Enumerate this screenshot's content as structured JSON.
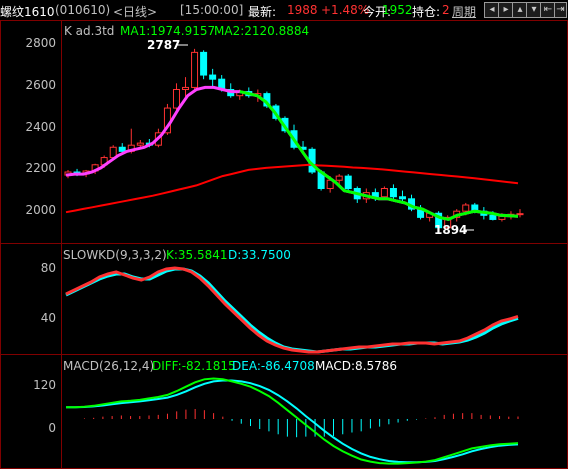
{
  "header": {
    "symbol": "螺纹1610",
    "code": "(010610)",
    "period": "<日线>",
    "time": "[15:00:00]",
    "last_label": "最新:",
    "last": "1988",
    "change": "+1.48%",
    "open_interest_label": "今开:",
    "open_interest": "1952",
    "position_label": "持仓:",
    "position": "2",
    "cycle_btn": "周期",
    "nav_icons": [
      "prev-icon",
      "next-icon",
      "zoom-in-icon",
      "zoom-out-icon",
      "first-icon",
      "last-icon"
    ]
  },
  "main_panel": {
    "title": "K  ad.3td",
    "ma1_label": "MA1:1974.9157",
    "ma2_label": "MA2:2120.8884",
    "high_marker": "2787",
    "low_marker": "1894",
    "y_ticks": [
      "2800",
      "2600",
      "2400",
      "2200",
      "2000"
    ]
  },
  "kd_panel": {
    "title": "SLOWKD(9,3,3,2)",
    "k_label": "K:35.5841",
    "d_label": "D:33.7500",
    "y_ticks": [
      "80",
      "40"
    ]
  },
  "macd_panel": {
    "title": "MACD(26,12,4)",
    "diff_label": "DIFF:-82.1815",
    "dea_label": "DEA:-86.4708",
    "macd_label": "MACD:8.5786",
    "y_ticks": [
      "120",
      "0"
    ]
  },
  "colors": {
    "up": "#ff3232",
    "down": "#00ffff",
    "ma1": "#ff40ff",
    "ma2": "#00ff00",
    "ma_long": "#ff0000",
    "grid": "#800000",
    "axis_text": "#c0c0c0",
    "title_text": "#c0c0c0",
    "green_label": "#00ff00",
    "cyan_label": "#00ffff",
    "white_label": "#ffffff"
  },
  "chart_data": [
    {
      "type": "candlestick",
      "title": "K ad.3td",
      "ylim": [
        1870,
        2830
      ],
      "series": [
        {
          "name": "MA1",
          "values": [
            2175,
            2180,
            2180,
            2190,
            2210,
            2240,
            2270,
            2290,
            2300,
            2310,
            2330,
            2370,
            2430,
            2500,
            2560,
            2590,
            2600,
            2600,
            2590,
            2580,
            2580,
            2570,
            2560,
            2530,
            2480,
            2420,
            2360,
            2300,
            2240,
            2200,
            2170,
            2140,
            2100,
            2090,
            2080,
            2070,
            2060,
            2060,
            2050,
            2040,
            2020,
            2010,
            1990,
            1970,
            1960,
            1980,
            1990,
            2000,
            1995,
            1990,
            1980,
            1978,
            1975
          ]
        },
        {
          "name": "MA2",
          "values": [
            1995,
            2003,
            2011,
            2019,
            2027,
            2035,
            2043,
            2051,
            2059,
            2067,
            2075,
            2085,
            2095,
            2105,
            2115,
            2125,
            2140,
            2155,
            2170,
            2180,
            2190,
            2200,
            2205,
            2210,
            2213,
            2216,
            2219,
            2222,
            2225,
            2222,
            2220,
            2218,
            2215,
            2212,
            2210,
            2207,
            2204,
            2200,
            2196,
            2192,
            2188,
            2184,
            2180,
            2176,
            2172,
            2168,
            2164,
            2160,
            2155,
            2150,
            2145,
            2140,
            2135
          ]
        }
      ],
      "candles": [
        {
          "o": 2175,
          "h": 2200,
          "l": 2160,
          "c": 2190
        },
        {
          "o": 2190,
          "h": 2205,
          "l": 2170,
          "c": 2180
        },
        {
          "o": 2180,
          "h": 2200,
          "l": 2165,
          "c": 2195
        },
        {
          "o": 2195,
          "h": 2230,
          "l": 2180,
          "c": 2225
        },
        {
          "o": 2225,
          "h": 2270,
          "l": 2210,
          "c": 2260
        },
        {
          "o": 2260,
          "h": 2320,
          "l": 2250,
          "c": 2310
        },
        {
          "o": 2310,
          "h": 2330,
          "l": 2280,
          "c": 2290
        },
        {
          "o": 2290,
          "h": 2400,
          "l": 2280,
          "c": 2320
        },
        {
          "o": 2320,
          "h": 2345,
          "l": 2300,
          "c": 2330
        },
        {
          "o": 2330,
          "h": 2350,
          "l": 2310,
          "c": 2320
        },
        {
          "o": 2320,
          "h": 2400,
          "l": 2310,
          "c": 2380
        },
        {
          "o": 2380,
          "h": 2520,
          "l": 2370,
          "c": 2500
        },
        {
          "o": 2500,
          "h": 2620,
          "l": 2490,
          "c": 2590
        },
        {
          "o": 2590,
          "h": 2650,
          "l": 2550,
          "c": 2600
        },
        {
          "o": 2600,
          "h": 2787,
          "l": 2580,
          "c": 2770
        },
        {
          "o": 2770,
          "h": 2780,
          "l": 2640,
          "c": 2660
        },
        {
          "o": 2660,
          "h": 2690,
          "l": 2600,
          "c": 2640
        },
        {
          "o": 2640,
          "h": 2660,
          "l": 2580,
          "c": 2590
        },
        {
          "o": 2590,
          "h": 2620,
          "l": 2550,
          "c": 2560
        },
        {
          "o": 2560,
          "h": 2590,
          "l": 2540,
          "c": 2580
        },
        {
          "o": 2580,
          "h": 2600,
          "l": 2550,
          "c": 2560
        },
        {
          "o": 2560,
          "h": 2590,
          "l": 2530,
          "c": 2570
        },
        {
          "o": 2570,
          "h": 2580,
          "l": 2500,
          "c": 2510
        },
        {
          "o": 2510,
          "h": 2520,
          "l": 2440,
          "c": 2450
        },
        {
          "o": 2450,
          "h": 2460,
          "l": 2380,
          "c": 2390
        },
        {
          "o": 2390,
          "h": 2420,
          "l": 2300,
          "c": 2310
        },
        {
          "o": 2310,
          "h": 2340,
          "l": 2280,
          "c": 2300
        },
        {
          "o": 2300,
          "h": 2310,
          "l": 2180,
          "c": 2190
        },
        {
          "o": 2190,
          "h": 2200,
          "l": 2100,
          "c": 2110
        },
        {
          "o": 2110,
          "h": 2170,
          "l": 2090,
          "c": 2150
        },
        {
          "o": 2150,
          "h": 2180,
          "l": 2120,
          "c": 2170
        },
        {
          "o": 2170,
          "h": 2180,
          "l": 2100,
          "c": 2110
        },
        {
          "o": 2110,
          "h": 2120,
          "l": 2040,
          "c": 2060
        },
        {
          "o": 2060,
          "h": 2110,
          "l": 2040,
          "c": 2090
        },
        {
          "o": 2090,
          "h": 2110,
          "l": 2050,
          "c": 2070
        },
        {
          "o": 2070,
          "h": 2120,
          "l": 2060,
          "c": 2110
        },
        {
          "o": 2110,
          "h": 2130,
          "l": 2060,
          "c": 2070
        },
        {
          "o": 2070,
          "h": 2100,
          "l": 2040,
          "c": 2060
        },
        {
          "o": 2060,
          "h": 2080,
          "l": 2000,
          "c": 2010
        },
        {
          "o": 2010,
          "h": 2030,
          "l": 1960,
          "c": 1970
        },
        {
          "o": 1970,
          "h": 2000,
          "l": 1950,
          "c": 1990
        },
        {
          "o": 1990,
          "h": 2000,
          "l": 1894,
          "c": 1920
        },
        {
          "o": 1920,
          "h": 1980,
          "l": 1910,
          "c": 1970
        },
        {
          "o": 1970,
          "h": 2010,
          "l": 1950,
          "c": 2000
        },
        {
          "o": 2000,
          "h": 2040,
          "l": 1980,
          "c": 2030
        },
        {
          "o": 2030,
          "h": 2040,
          "l": 1990,
          "c": 2000
        },
        {
          "o": 2000,
          "h": 2020,
          "l": 1960,
          "c": 1980
        },
        {
          "o": 1980,
          "h": 2000,
          "l": 1955,
          "c": 1960
        },
        {
          "o": 1960,
          "h": 1990,
          "l": 1950,
          "c": 1975
        },
        {
          "o": 1975,
          "h": 2000,
          "l": 1960,
          "c": 1985
        },
        {
          "o": 1985,
          "h": 2010,
          "l": 1970,
          "c": 1988
        }
      ]
    },
    {
      "type": "line",
      "title": "SLOWKD(9,3,3,2)",
      "ylim": [
        0,
        90
      ],
      "series": [
        {
          "name": "K",
          "values": [
            58,
            62,
            66,
            70,
            75,
            78,
            80,
            77,
            74,
            72,
            75,
            80,
            83,
            84,
            83,
            80,
            74,
            66,
            57,
            48,
            40,
            32,
            24,
            17,
            11,
            7,
            4,
            2,
            1,
            0,
            0,
            1,
            2,
            3,
            4,
            5,
            5,
            6,
            7,
            8,
            8,
            9,
            9,
            9,
            8,
            9,
            10,
            11,
            14,
            18,
            22,
            27,
            31,
            33,
            35.6
          ]
        },
        {
          "name": "D",
          "values": [
            57,
            61,
            65,
            69,
            73,
            76,
            78,
            78,
            75,
            73,
            73,
            77,
            81,
            83,
            83,
            81,
            76,
            69,
            60,
            51,
            43,
            35,
            27,
            20,
            14,
            9,
            5,
            3,
            2,
            1,
            0,
            1,
            2,
            3,
            3,
            4,
            5,
            5,
            6,
            7,
            8,
            8,
            9,
            9,
            9,
            8,
            9,
            10,
            12,
            15,
            19,
            24,
            28,
            31,
            33.75
          ]
        }
      ]
    },
    {
      "type": "line",
      "title": "MACD(26,12,4)",
      "ylim": [
        -160,
        160
      ],
      "series": [
        {
          "name": "DIFF",
          "values": [
            40,
            40,
            42,
            45,
            50,
            55,
            60,
            62,
            65,
            70,
            75,
            82,
            95,
            110,
            125,
            135,
            138,
            135,
            128,
            120,
            110,
            95,
            78,
            55,
            30,
            5,
            -20,
            -45,
            -70,
            -92,
            -110,
            -125,
            -138,
            -145,
            -150,
            -152,
            -152,
            -150,
            -148,
            -145,
            -140,
            -130,
            -120,
            -110,
            -100,
            -95,
            -90,
            -86,
            -84,
            -82.2
          ]
        },
        {
          "name": "DEA",
          "values": [
            40,
            40,
            41,
            43,
            46,
            50,
            54,
            57,
            60,
            64,
            68,
            73,
            82,
            94,
            108,
            120,
            128,
            131,
            131,
            128,
            122,
            112,
            99,
            81,
            60,
            36,
            10,
            -15,
            -40,
            -63,
            -84,
            -102,
            -117,
            -129,
            -137,
            -143,
            -146,
            -147,
            -147,
            -146,
            -143,
            -137,
            -129,
            -120,
            -110,
            -102,
            -96,
            -91,
            -88,
            -86.5
          ]
        },
        {
          "name": "MACD",
          "values": [
            0,
            0,
            2,
            4,
            8,
            10,
            12,
            10,
            10,
            12,
            14,
            18,
            26,
            32,
            34,
            30,
            20,
            8,
            -6,
            -16,
            -24,
            -34,
            -42,
            -52,
            -60,
            -62,
            -60,
            -60,
            -60,
            -58,
            -52,
            -46,
            -42,
            -32,
            -26,
            -18,
            -12,
            -6,
            -2,
            2,
            6,
            14,
            18,
            20,
            20,
            14,
            12,
            10,
            8,
            8.6
          ]
        }
      ]
    }
  ]
}
